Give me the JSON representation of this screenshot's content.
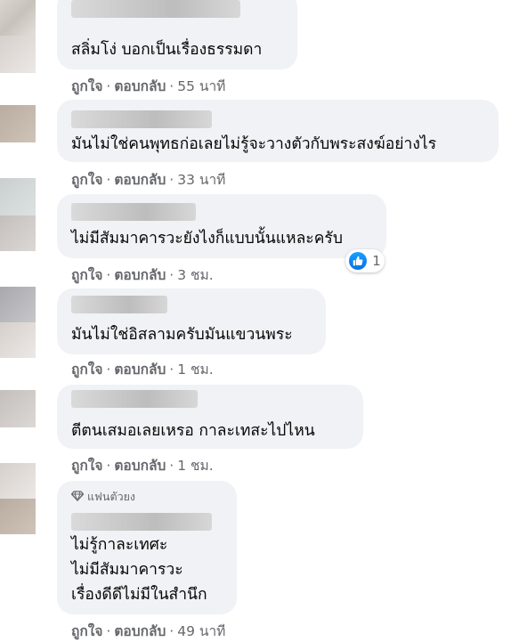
{
  "comments": [
    {
      "text_lines": [
        "สลิ่มโง่ บอกเป็นเรื่องธรรมดา"
      ],
      "like_label": "ถูกใจ",
      "reply_label": "ตอบกลับ",
      "time": "55 นาที"
    },
    {
      "text_lines": [
        "มันไม่ใช่คนพุทธก่อเลยไม่รู้จะวางตัวกับพระสงฆ์อย่างไร"
      ],
      "like_label": "ถูกใจ",
      "reply_label": "ตอบกลับ",
      "time": "33 นาที"
    },
    {
      "text_lines": [
        "ไม่มีสัมมาคารวะยังไงก็แบบนั้นแหละครับ"
      ],
      "like_label": "ถูกใจ",
      "reply_label": "ตอบกลับ",
      "time": "3 ชม.",
      "reaction_count": "1"
    },
    {
      "text_lines": [
        "มันไม่ใช่อิสลามครับมันแขวนพระ"
      ],
      "like_label": "ถูกใจ",
      "reply_label": "ตอบกลับ",
      "time": "1 ชม."
    },
    {
      "text_lines": [
        "ตีตนเสมอเลยเหรอ กาละเทสะไปไหน"
      ],
      "like_label": "ถูกใจ",
      "reply_label": "ตอบกลับ",
      "time": "1 ชม."
    },
    {
      "badge": "แฟนตัวยง",
      "text_lines": [
        "ไม่รู้กาละเทศะ",
        "ไม่มีสัมมาคารวะ",
        "เรื่องดีดีไม่มีในสำนึก"
      ],
      "like_label": "ถูกใจ",
      "reply_label": "ตอบกลับ",
      "time": "49 นาที"
    }
  ],
  "separator": "·",
  "colors": {
    "bubble": "#f0f2f5",
    "secondary_text": "#65676b",
    "like_blue": "#1877f2"
  },
  "icons": {
    "badge": "diamond-icon",
    "reaction": "thumbs-up-icon"
  }
}
